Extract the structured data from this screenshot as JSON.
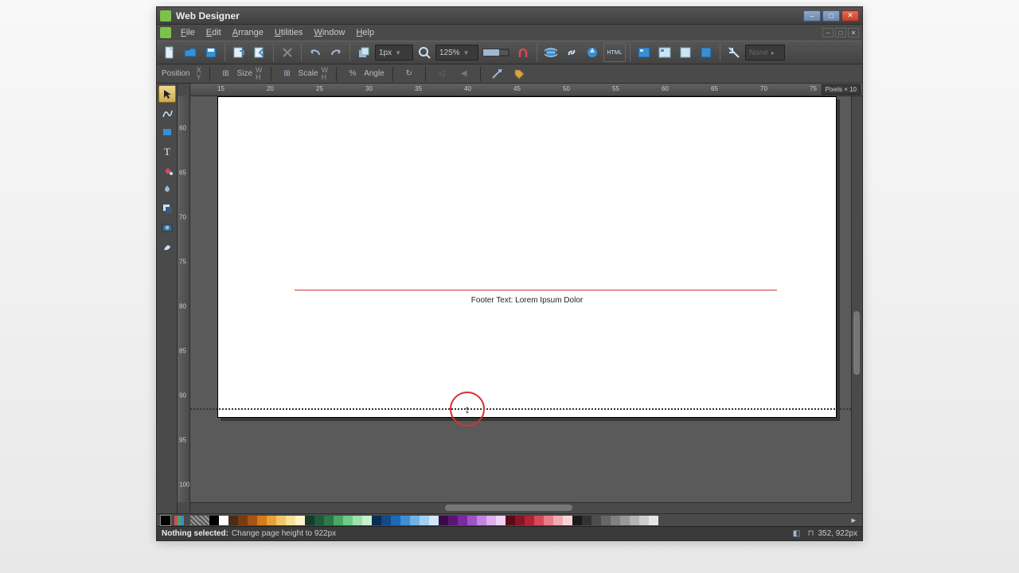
{
  "title": "Web Designer",
  "menus": [
    "File",
    "Edit",
    "Arrange",
    "Utilities",
    "Window",
    "Help"
  ],
  "toolbar": {
    "stroke_width": "1px",
    "zoom": "125%",
    "none_label": "None"
  },
  "infobar": {
    "position_label": "Position",
    "size_label": "Size",
    "scale_label": "Scale",
    "angle_label": "Angle"
  },
  "ruler_units": "Pixels × 10",
  "hruler_ticks": [
    "15",
    "20",
    "25",
    "30",
    "35",
    "40",
    "45",
    "50",
    "55",
    "60",
    "65",
    "70",
    "75"
  ],
  "vruler_ticks": [
    "60",
    "65",
    "70",
    "75",
    "80",
    "85",
    "90",
    "95",
    "100"
  ],
  "canvas": {
    "footer_text": "Footer Text: Lorem Ipsum Dolor"
  },
  "status": {
    "selection_label": "Nothing selected:",
    "hint": "Change page height to 922px",
    "coords": "352, 922px"
  },
  "colors": [
    "#000000",
    "#ffffff",
    "#4a2c17",
    "#7a3b11",
    "#a75216",
    "#d47c1a",
    "#e8a23a",
    "#f3c768",
    "#f8e29a",
    "#fff3c9",
    "#153b2c",
    "#1f5a3c",
    "#2a7a4c",
    "#4aa866",
    "#6ecb88",
    "#9ce3ad",
    "#c8f0cd",
    "#0a2c55",
    "#124a86",
    "#1a6ab7",
    "#3f8fd2",
    "#72b3e6",
    "#a3d0f1",
    "#d0e7f8",
    "#3a0a4d",
    "#5a1676",
    "#7a2aa0",
    "#9f54c6",
    "#c184df",
    "#dcb0ed",
    "#eed4f6",
    "#5a0a1a",
    "#861627",
    "#b32235",
    "#d54a5a",
    "#e87d88",
    "#f2abb2",
    "#f9d5d9",
    "#1a1a1a",
    "#333333",
    "#4d4d4d",
    "#666666",
    "#808080",
    "#999999",
    "#b3b3b3",
    "#cccccc",
    "#e6e6e6"
  ]
}
